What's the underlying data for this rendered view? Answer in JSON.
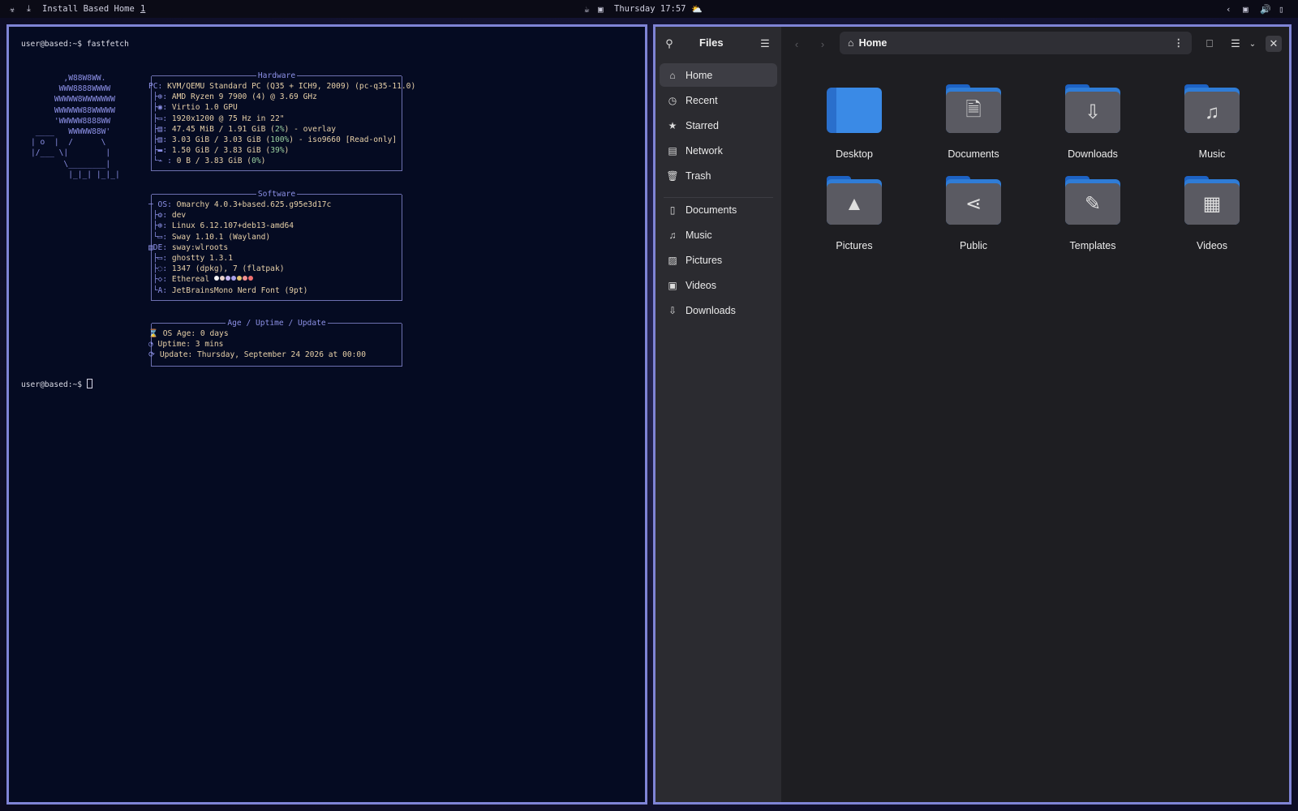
{
  "topbar": {
    "app_title": "Install Based Home",
    "workspace": "1",
    "clock": "Thursday 17:57",
    "icons": [
      "distro-logo-icon",
      "download-icon",
      "coffee-icon",
      "display-icon",
      "weather-icon",
      "chevron-left-icon",
      "screen-icon",
      "volume-icon",
      "battery-icon"
    ]
  },
  "terminal": {
    "prompt1": "user@based:~$ fastfetch",
    "prompt2": "user@based:~$ ",
    "logo": "       ,W88W8WW.\n      WWW8888WWWW\n     WWWWW8WWWWWWW\n     WWWWWW88WWWWW\n     'WWWWW8888WW\n ____   WWWWW88W'\n| o  |  /      \\\n|/___ \\|        |\n       \\________|\n        |_|_| |_|_|",
    "hardware": {
      "title": "Hardware",
      "lines": [
        {
          "key": "PC:",
          "value": " KVM/QEMU Standard PC (Q35 + ICH9, 2009) (pc-q35-11.0)"
        },
        {
          "key": " ├⊕:",
          "value": " AMD Ryzen 9 7900 (4) @ 3.69 GHz"
        },
        {
          "key": " ├◉:",
          "value": " Virtio 1.0 GPU"
        },
        {
          "key": " ├▭:",
          "value": " 1920x1200 @ 75 Hz in 22\""
        },
        {
          "key": " ├▤:",
          "value": " 47.45 MiB / 1.91 GiB (",
          "pct": "2%",
          "tail": ") - overlay"
        },
        {
          "key": " ├▤:",
          "value": " 3.03 GiB / 3.03 GiB (",
          "pct": "100%",
          "tail": ") - iso9660 [Read-only]"
        },
        {
          "key": " ├▬:",
          "value": " 1.50 GiB / 3.83 GiB (",
          "pct": "39%",
          "tail": ")"
        },
        {
          "key": " └⌁ :",
          "value": " 0 B / 3.83 GiB (",
          "pct": "0%",
          "tail": ")"
        }
      ]
    },
    "software": {
      "title": "Software",
      "lines": [
        {
          "key": "─ OS:",
          "value": " Omarchy 4.0.3+based.625.g95e3d17c"
        },
        {
          "key": " ├⚙:",
          "value": " dev"
        },
        {
          "key": " ├⊕:",
          "value": " Linux 6.12.107+deb13-amd64"
        },
        {
          "key": " └▭:",
          "value": " Sway 1.10.1 (Wayland)"
        },
        {
          "key": "▤DE:",
          "value": " sway:wlroots"
        },
        {
          "key": " ├▭:",
          "value": " ghostty 1.3.1"
        },
        {
          "key": " ├◌:",
          "value": " 1347 (dpkg), 7 (flatpak)"
        },
        {
          "key": " ├◇:",
          "value": " Ethereal "
        },
        {
          "key": " └A:",
          "value": " JetBrainsMono Nerd Font (9pt)"
        }
      ],
      "swatches": [
        "#f4f4f4",
        "#e8d0c8",
        "#c8b8f0",
        "#a8a0e8",
        "#e0c070",
        "#f09090",
        "#f07070"
      ]
    },
    "age": {
      "title": "Age / Uptime / Update",
      "lines": [
        {
          "key": "⌛",
          "value": " OS Age: 0 days"
        },
        {
          "key": "◔",
          "value": " Uptime: 3 mins"
        },
        {
          "key": "⟳",
          "value": " Update: Thursday, September 24 2026 at 00:00"
        }
      ]
    }
  },
  "files": {
    "sidebar_title": "Files",
    "places": [
      {
        "label": "Home",
        "icon": "⌂",
        "active": true
      },
      {
        "label": "Recent",
        "icon": "◷"
      },
      {
        "label": "Starred",
        "icon": "★"
      },
      {
        "label": "Network",
        "icon": "▤"
      },
      {
        "label": "Trash",
        "icon": "🗑"
      }
    ],
    "bookmarks": [
      {
        "label": "Documents",
        "icon": "▯"
      },
      {
        "label": "Music",
        "icon": "♫"
      },
      {
        "label": "Pictures",
        "icon": "▨"
      },
      {
        "label": "Videos",
        "icon": "▣"
      },
      {
        "label": "Downloads",
        "icon": "⇩"
      }
    ],
    "path": "Home",
    "folders": [
      {
        "label": "Desktop",
        "glyph": ""
      },
      {
        "label": "Documents",
        "glyph": "🗎"
      },
      {
        "label": "Downloads",
        "glyph": "⇩"
      },
      {
        "label": "Music",
        "glyph": "♫"
      },
      {
        "label": "Pictures",
        "glyph": "▲"
      },
      {
        "label": "Public",
        "glyph": "⋖"
      },
      {
        "label": "Templates",
        "glyph": "✎"
      },
      {
        "label": "Videos",
        "glyph": "▦"
      }
    ]
  },
  "colors": {
    "border": "#7f84d6",
    "terminal_bg": "#050b22",
    "accent_purple": "#8c90e6",
    "value_tan": "#e7d0a8",
    "folder_blue": "#2f7cd6"
  }
}
